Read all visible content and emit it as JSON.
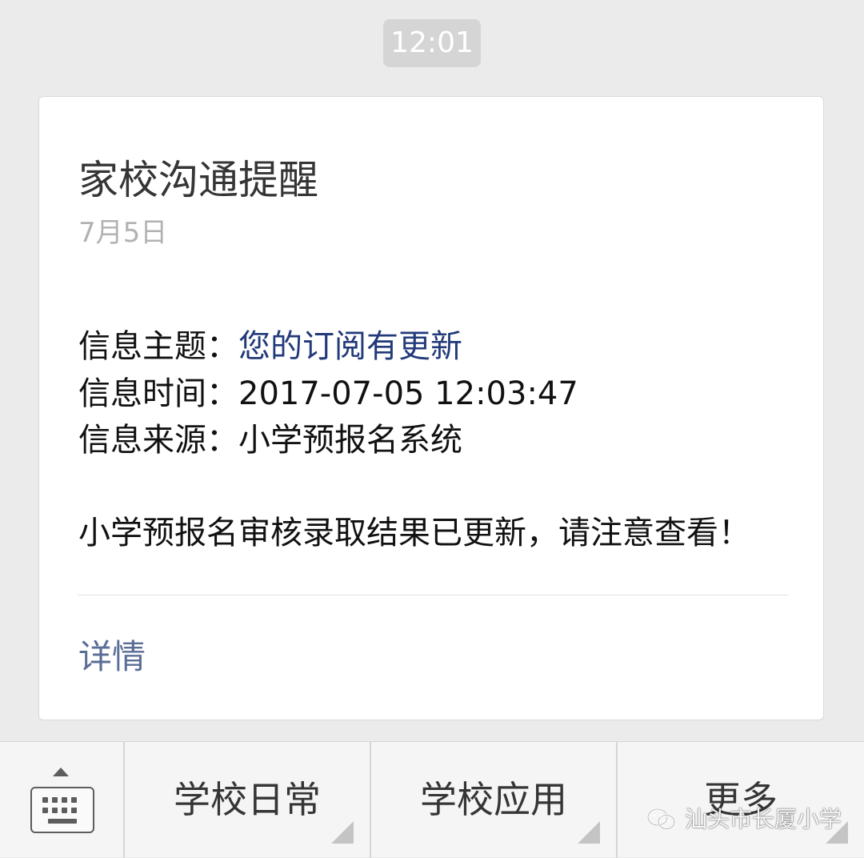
{
  "chat": {
    "timestamp": "12:01"
  },
  "card": {
    "title": "家校沟通提醒",
    "date": "7月5日",
    "lines": [
      {
        "label": "信息主题：",
        "value": "您的订阅有更新"
      },
      {
        "label": "信息时间：",
        "value": "2017-07-05 12:03:47"
      },
      {
        "label": "信息来源：",
        "value": "小学预报名系统"
      }
    ],
    "body": "小学预报名审核录取结果已更新，请注意查看！",
    "detail_label": "详情"
  },
  "menu": {
    "keyboard_icon": "keyboard-icon",
    "items": [
      {
        "label": "学校日常"
      },
      {
        "label": "学校应用"
      },
      {
        "label": "更多"
      }
    ]
  },
  "watermark": {
    "icon": "wechat-icon",
    "text": "汕头市长厦小学"
  },
  "colors": {
    "background": "#ebebeb",
    "card": "#ffffff",
    "accent_value": "#223a7a",
    "link": "#5a6d95",
    "muted": "#b2b2b2",
    "title": "#353535"
  }
}
